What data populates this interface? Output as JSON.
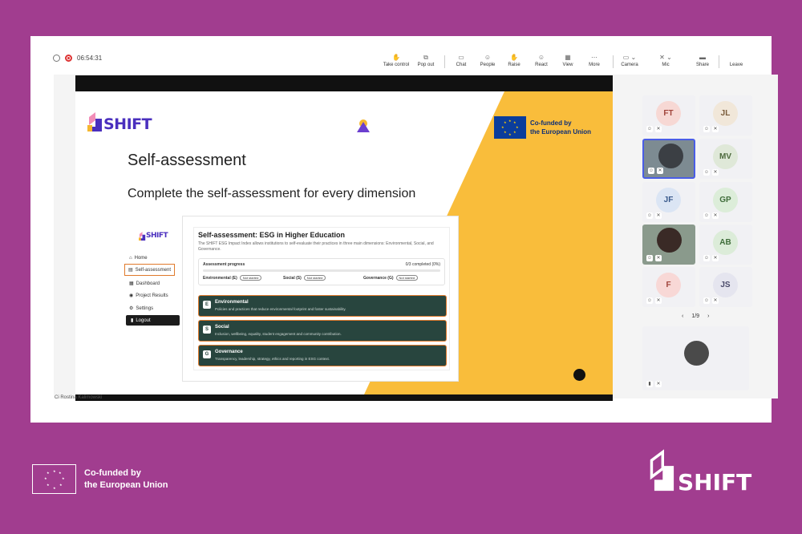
{
  "meeting": {
    "timer": "06:54:31",
    "toolbar": [
      {
        "label": "Take control",
        "icon": "hand-icon"
      },
      {
        "label": "Pop out",
        "icon": "popout-icon"
      },
      {
        "label": "Chat",
        "icon": "chat-icon"
      },
      {
        "label": "People",
        "icon": "people-icon"
      },
      {
        "label": "Raise",
        "icon": "raise-hand-icon"
      },
      {
        "label": "React",
        "icon": "react-icon"
      },
      {
        "label": "View",
        "icon": "view-icon"
      },
      {
        "label": "More",
        "icon": "more-icon"
      },
      {
        "label": "Camera",
        "icon": "camera-icon"
      },
      {
        "label": "Mic",
        "icon": "mic-icon"
      },
      {
        "label": "Share",
        "icon": "share-icon"
      },
      {
        "label": "Leave",
        "icon": "leave-icon"
      }
    ],
    "presenter_name": "Ci Rostina Kalimowski",
    "participants": [
      {
        "initials": "FT",
        "bg": "#f7d8d4",
        "fg": "#a0433a"
      },
      {
        "initials": "JL",
        "bg": "#f1e7d9",
        "fg": "#7a5b3a"
      },
      {
        "initials": "",
        "bg": "#5b6870",
        "fg": "#ffffff"
      },
      {
        "initials": "MV",
        "bg": "#dfe8d8",
        "fg": "#4d6a3d"
      },
      {
        "initials": "JF",
        "bg": "#dbe5f4",
        "fg": "#3a5a8c"
      },
      {
        "initials": "GP",
        "bg": "#dcedd9",
        "fg": "#3f6d3a"
      },
      {
        "initials": "",
        "bg": "#c8b9b0",
        "fg": "#ffffff"
      },
      {
        "initials": "AB",
        "bg": "#dcecd9",
        "fg": "#3f6d3a"
      },
      {
        "initials": "F",
        "bg": "#f8d8d6",
        "fg": "#a0433a"
      },
      {
        "initials": "JS",
        "bg": "#e5e5ef",
        "fg": "#4a4a6a"
      }
    ],
    "pager": "1/9",
    "pager_prev": "‹",
    "pager_next": "›"
  },
  "slide": {
    "logo": "SHIFT",
    "title": "Self-assessment",
    "subtitle": "Complete the self-assessment for every dimension",
    "eu_line1": "Co-funded by",
    "eu_line2": "the European Union",
    "app": {
      "logo": "SHIFT",
      "nav": [
        "Home",
        "Self-assessment",
        "Dashboard",
        "Project Results",
        "Settings"
      ],
      "logout": "Logout",
      "title": "Self-assessment: ESG in Higher Education",
      "description": "The SHIFT ESG Impact Index allows institutions to self-evaluate their practices in three main dimensions: Environmental, Social, and Governance.",
      "progress_label": "Assessment progress",
      "progress_count": "0/3 completed (0%)",
      "progress_fraction": 0,
      "dimensions": [
        {
          "name": "Environmental (E)",
          "status": "Not started"
        },
        {
          "name": "Social (S)",
          "status": "Not started"
        },
        {
          "name": "Governance (G)",
          "status": "Not started"
        }
      ],
      "cards": [
        {
          "letter": "E",
          "title": "Environmental",
          "desc": "Policies and practices that reduce environmental footprint and foster sustainability."
        },
        {
          "letter": "S",
          "title": "Social",
          "desc": "Inclusion, wellbeing, equality, student engagement and community contribution."
        },
        {
          "letter": "G",
          "title": "Governance",
          "desc": "Transparency, leadership, strategy, ethics and reporting in ESG context."
        }
      ]
    }
  },
  "footer": {
    "eu_line1": "Co-funded by",
    "eu_line2": "the European Union",
    "logo": "SHIFT"
  },
  "colors": {
    "background": "#a13d8f",
    "brand_purple": "#4a2fbe",
    "yellow": "#f9bd3b",
    "card_green": "#28453e",
    "highlight_orange": "#e07a2c",
    "eu_blue": "#0b3d9b"
  }
}
